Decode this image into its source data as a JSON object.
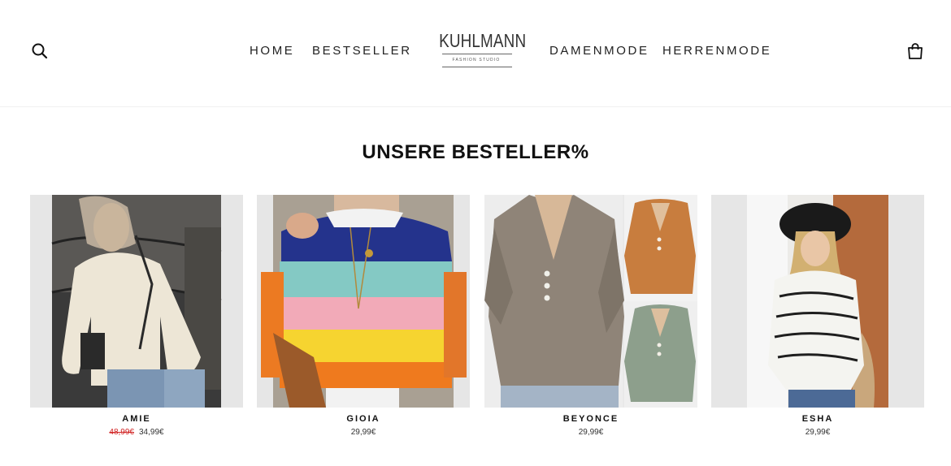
{
  "header": {
    "nav": [
      "HOME",
      "BESTSELLER",
      "DAMENMODE",
      "HERRENMODE"
    ],
    "logo": {
      "name": "KUHLMANN",
      "tagline": "FASHION STUDIO"
    },
    "icons": {
      "search": "search-icon",
      "cart": "shopping-bag-icon"
    }
  },
  "section": {
    "title": "UNSERE BESTELLER%"
  },
  "products": [
    {
      "name": "AMIE",
      "old_price": "48,99€",
      "price": "34,99€"
    },
    {
      "name": "GIOIA",
      "price": "29,99€"
    },
    {
      "name": "BEYONCE",
      "price": "29,99€"
    },
    {
      "name": "ESHA",
      "price": "29,99€"
    }
  ],
  "colors": {
    "image_bg": "#e6e6e6",
    "sale_red": "#d02020"
  }
}
